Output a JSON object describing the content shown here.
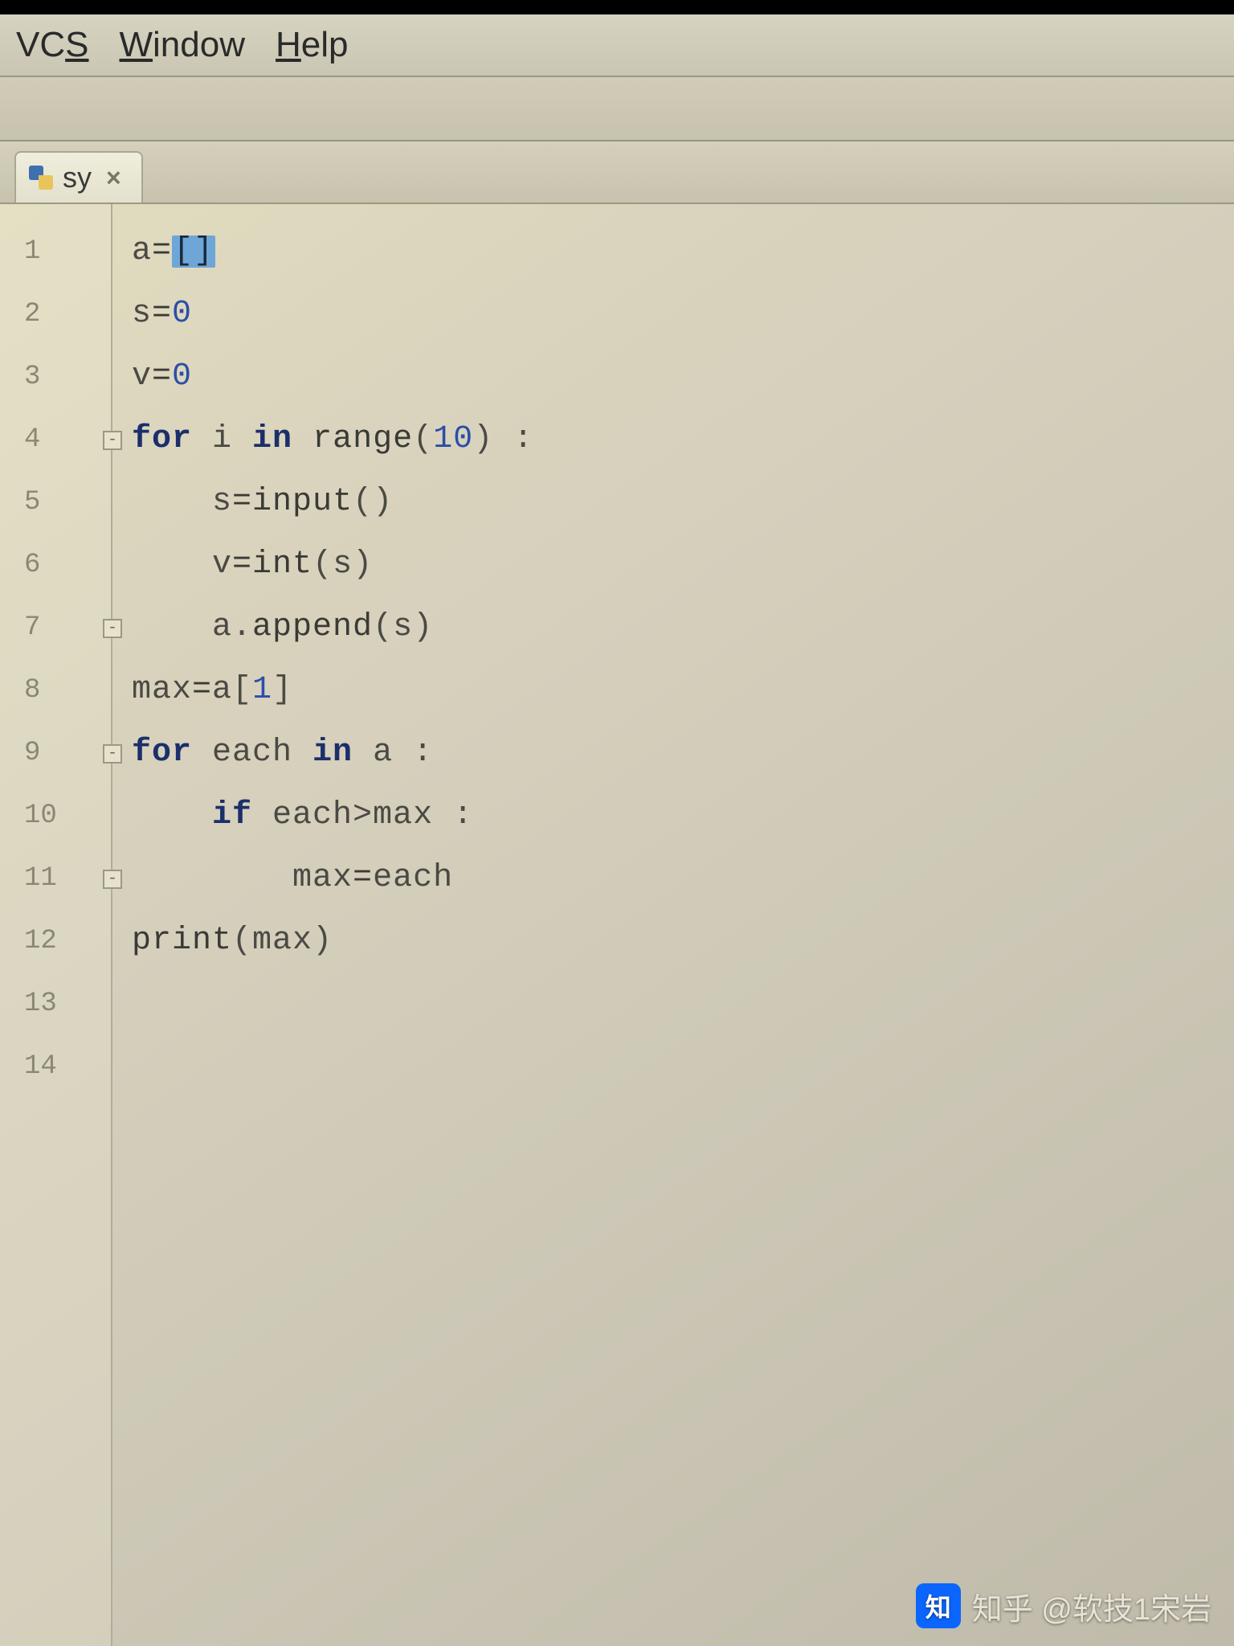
{
  "menubar": {
    "items": [
      {
        "label": "VCS",
        "accel_index": 2
      },
      {
        "label": "Window",
        "accel_index": 0
      },
      {
        "label": "Help",
        "accel_index": 0
      }
    ]
  },
  "tab": {
    "filename": "sy",
    "close_glyph": "×"
  },
  "gutter": {
    "numbers": [
      "1",
      "2",
      "3",
      "4",
      "5",
      "6",
      "7",
      "8",
      "9",
      "10",
      "11",
      "12",
      "13",
      "14"
    ],
    "fold_marks": {
      "4": "-",
      "7": "-",
      "9": "-",
      "11": "-"
    }
  },
  "code": {
    "lines": [
      {
        "indent": 0,
        "tokens": [
          {
            "t": "txt",
            "v": "a"
          },
          {
            "t": "op",
            "v": "="
          },
          {
            "t": "sel",
            "v": "[]"
          }
        ]
      },
      {
        "indent": 0,
        "tokens": [
          {
            "t": "txt",
            "v": "s"
          },
          {
            "t": "op",
            "v": "="
          },
          {
            "t": "num",
            "v": "0"
          }
        ]
      },
      {
        "indent": 0,
        "tokens": [
          {
            "t": "txt",
            "v": "v"
          },
          {
            "t": "op",
            "v": "="
          },
          {
            "t": "num",
            "v": "0"
          }
        ]
      },
      {
        "indent": 0,
        "tokens": [
          {
            "t": "kw",
            "v": "for"
          },
          {
            "t": "txt",
            "v": " i "
          },
          {
            "t": "kw",
            "v": "in"
          },
          {
            "t": "txt",
            "v": " "
          },
          {
            "t": "fn",
            "v": "range"
          },
          {
            "t": "txt",
            "v": "("
          },
          {
            "t": "num",
            "v": "10"
          },
          {
            "t": "txt",
            "v": ") :"
          }
        ]
      },
      {
        "indent": 1,
        "tokens": [
          {
            "t": "txt",
            "v": "s"
          },
          {
            "t": "op",
            "v": "="
          },
          {
            "t": "fn",
            "v": "input"
          },
          {
            "t": "txt",
            "v": "()"
          }
        ]
      },
      {
        "indent": 1,
        "tokens": [
          {
            "t": "txt",
            "v": "v"
          },
          {
            "t": "op",
            "v": "="
          },
          {
            "t": "fn",
            "v": "int"
          },
          {
            "t": "txt",
            "v": "(s)"
          }
        ]
      },
      {
        "indent": 1,
        "tokens": [
          {
            "t": "txt",
            "v": "a."
          },
          {
            "t": "fn",
            "v": "append"
          },
          {
            "t": "txt",
            "v": "(s)"
          }
        ]
      },
      {
        "indent": 0,
        "tokens": [
          {
            "t": "txt",
            "v": "max"
          },
          {
            "t": "op",
            "v": "="
          },
          {
            "t": "txt",
            "v": "a["
          },
          {
            "t": "num",
            "v": "1"
          },
          {
            "t": "txt",
            "v": "]"
          }
        ]
      },
      {
        "indent": 0,
        "tokens": [
          {
            "t": "kw",
            "v": "for"
          },
          {
            "t": "txt",
            "v": " each "
          },
          {
            "t": "kw",
            "v": "in"
          },
          {
            "t": "txt",
            "v": " a :"
          }
        ]
      },
      {
        "indent": 1,
        "tokens": [
          {
            "t": "kw",
            "v": "if"
          },
          {
            "t": "txt",
            "v": " each>max :"
          }
        ]
      },
      {
        "indent": 2,
        "tokens": [
          {
            "t": "txt",
            "v": "max"
          },
          {
            "t": "op",
            "v": "="
          },
          {
            "t": "txt",
            "v": "each"
          }
        ]
      },
      {
        "indent": 0,
        "tokens": [
          {
            "t": "fn",
            "v": "print"
          },
          {
            "t": "txt",
            "v": "(max)"
          }
        ]
      },
      {
        "indent": 0,
        "tokens": []
      },
      {
        "indent": 0,
        "tokens": []
      }
    ],
    "indent_unit": "    "
  },
  "watermark": {
    "logo_text": "知",
    "text": "知乎 @软技1宋岩"
  }
}
